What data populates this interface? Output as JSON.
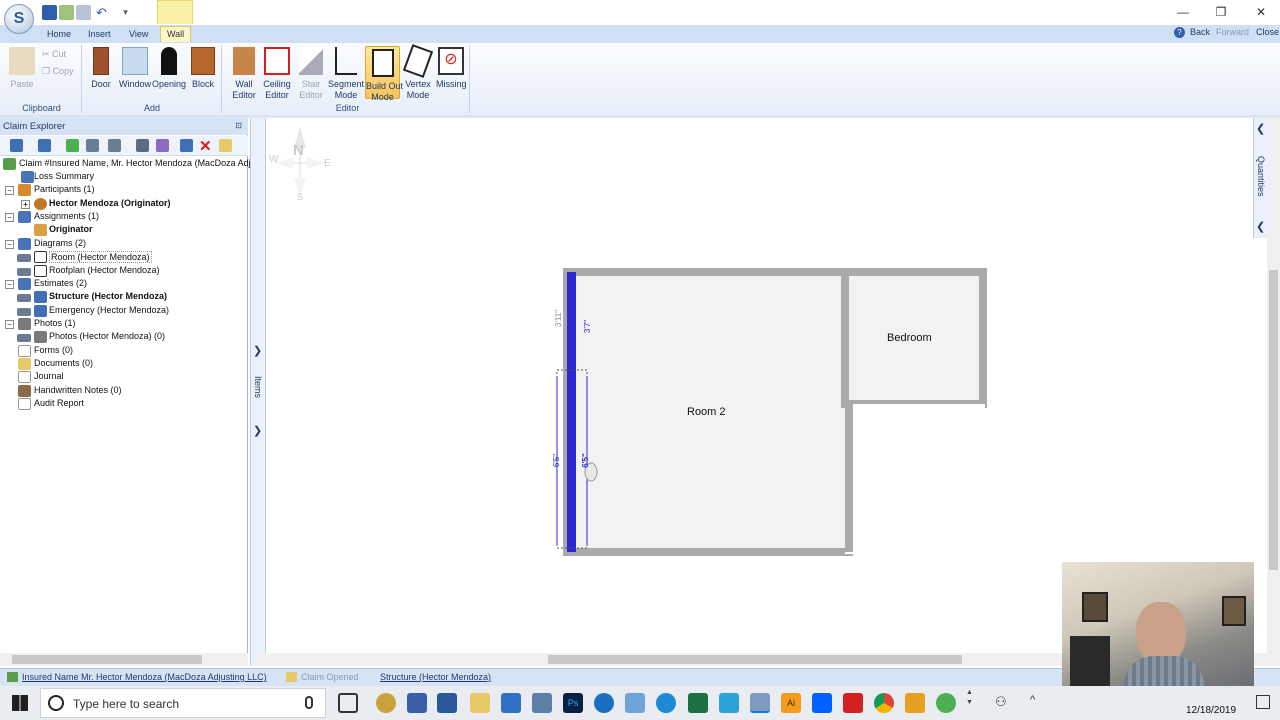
{
  "titlebar": {
    "back": "Back",
    "forward": "Forward",
    "close": "Close"
  },
  "tabs": [
    "Home",
    "Insert",
    "View",
    "Wall"
  ],
  "ribbon": {
    "clipboard": {
      "label": "Clipboard",
      "paste": "Paste",
      "cut": "Cut",
      "copy": "Copy"
    },
    "add": {
      "label": "Add",
      "door": "Door",
      "window": "Window",
      "opening": "Opening",
      "block": "Block"
    },
    "editor": {
      "label": "Editor",
      "wall_editor": "Wall\nEditor",
      "ceiling_editor": "Ceiling\nEditor",
      "stair_editor": "Stair\nEditor",
      "segment_mode": "Segment\nMode",
      "build_out_mode": "Build Out\nMode",
      "vertex_mode": "Vertex\nMode",
      "missing": "Missing"
    }
  },
  "explorer": {
    "title": "Claim Explorer",
    "tree": [
      {
        "label": "Claim #Insured Name, Mr. Hector Mendoza (MacDoza Adju",
        "bold": false
      },
      {
        "label": "Loss Summary",
        "bold": false
      },
      {
        "label": "Participants (1)",
        "bold": false
      },
      {
        "label": "Hector Mendoza (Originator)",
        "bold": true
      },
      {
        "label": "Assignments (1)",
        "bold": false
      },
      {
        "label": "Originator",
        "bold": true
      },
      {
        "label": "Diagrams (2)",
        "bold": false
      },
      {
        "label": "Room (Hector Mendoza)",
        "bold": false
      },
      {
        "label": "Roofplan (Hector Mendoza)",
        "bold": false
      },
      {
        "label": "Estimates (2)",
        "bold": false
      },
      {
        "label": "Structure (Hector Mendoza)",
        "bold": true
      },
      {
        "label": "Emergency (Hector Mendoza)",
        "bold": false
      },
      {
        "label": "Photos (1)",
        "bold": false
      },
      {
        "label": "Photos (Hector Mendoza) (0)",
        "bold": false
      },
      {
        "label": "Forms (0)",
        "bold": false
      },
      {
        "label": "Documents (0)",
        "bold": false
      },
      {
        "label": "Journal",
        "bold": false
      },
      {
        "label": "Handwritten Notes (0)",
        "bold": false
      },
      {
        "label": "Audit Report",
        "bold": false
      }
    ]
  },
  "sidebar": {
    "items": "Items",
    "quantities": "Quantities"
  },
  "compass": {
    "n": "N",
    "s": "S",
    "e": "E",
    "w": "W"
  },
  "diagram": {
    "room2": "Room 2",
    "bedroom": "Bedroom",
    "dim_3_11": "3'11\"",
    "dim_3_7": "3'7\"",
    "dim_6_5a": "6'5\"",
    "dim_6_5b": "6'5\""
  },
  "status": {
    "claim": "Insured Name Mr. Hector Mendoza (MacDoza Adjusting LLC)",
    "opened": "Claim Opened",
    "structure": "Structure (Hector Mendoza)"
  },
  "taskbar": {
    "search_placeholder": "Type here to search",
    "date": "12/18/2019"
  }
}
